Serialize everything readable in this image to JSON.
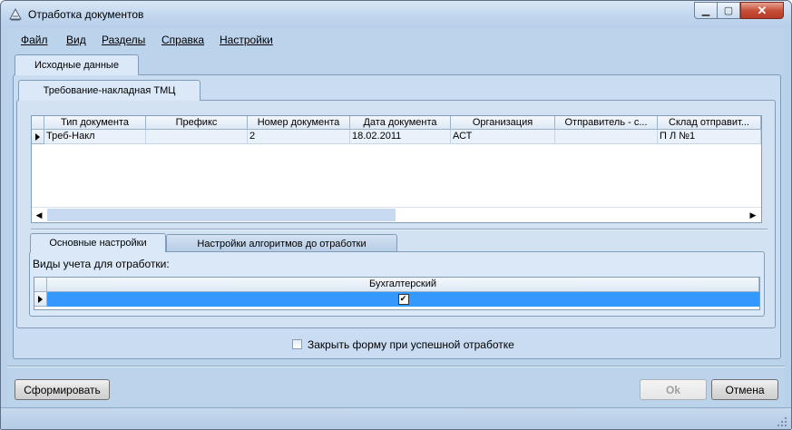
{
  "window": {
    "title": "Отработка документов"
  },
  "menu": [
    "Файл",
    "Вид",
    "Разделы",
    "Справка",
    "Настройки"
  ],
  "outer_tab": "Исходные данные",
  "doc_tab": "Требование-накладная ТМЦ",
  "documents_grid": {
    "columns": [
      "Тип документа",
      "Префикс",
      "Номер документа",
      "Дата документа",
      "Организация",
      "Отправитель - с...",
      "Склад отправит..."
    ],
    "rows": [
      [
        "Треб-Накл",
        "",
        "2",
        "18.02.2011",
        "АСТ",
        "",
        "П Л №1"
      ]
    ]
  },
  "settings_tabs": [
    "Основные настройки",
    "Настройки алгоритмов до отработки"
  ],
  "accounting": {
    "label": "Виды учета для отработки:",
    "column": "Бухгалтерский",
    "checked": "✔"
  },
  "close_on_success": "Закрыть форму при успешной отработке",
  "buttons": {
    "generate": "Сформировать",
    "ok": "Ok",
    "cancel": "Отмена"
  },
  "colors": {
    "selection": "#3399ff",
    "window_bg": "#bcd3ec"
  }
}
